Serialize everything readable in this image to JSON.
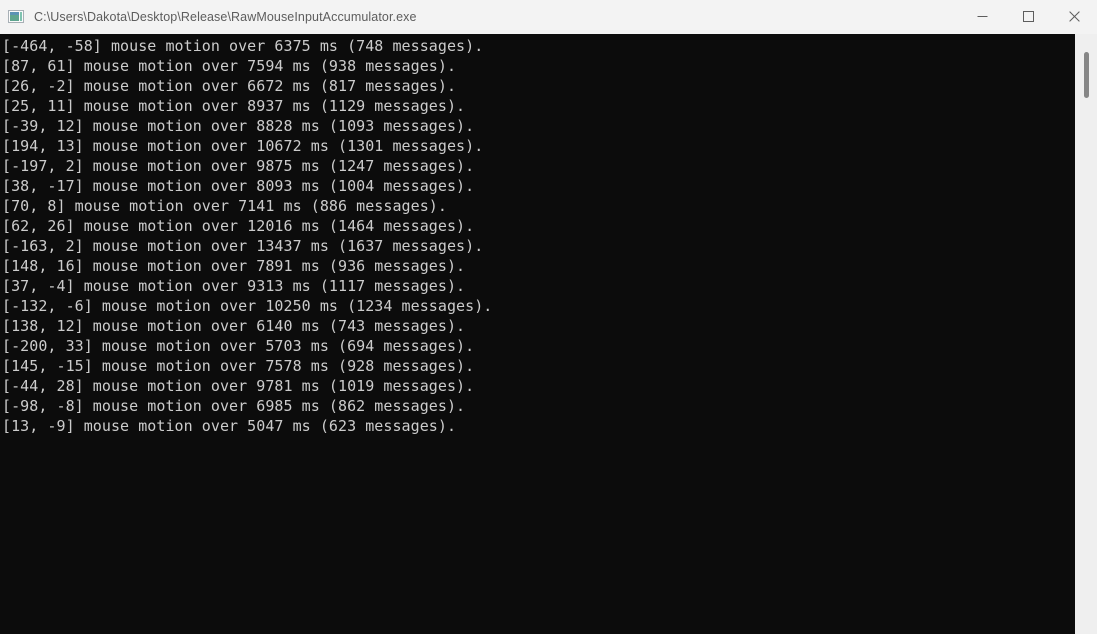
{
  "window": {
    "title": "C:\\Users\\Dakota\\Desktop\\Release\\RawMouseInputAccumulator.exe",
    "icon_name": "console-app-icon",
    "background_color": "#0c0c0c",
    "titlebar_color": "#f3f3f3",
    "text_color": "#cccccc",
    "title_text_color": "#5d5d5d"
  },
  "controls": {
    "minimize_label": "Minimize",
    "maximize_label": "Maximize",
    "close_label": "Close"
  },
  "scrollbar": {
    "thumb_color": "#868686",
    "track_color": "#efefef"
  },
  "console": {
    "lines": [
      "[-464, -58] mouse motion over 6375 ms (748 messages).",
      "[87, 61] mouse motion over 7594 ms (938 messages).",
      "[26, -2] mouse motion over 6672 ms (817 messages).",
      "[25, 11] mouse motion over 8937 ms (1129 messages).",
      "[-39, 12] mouse motion over 8828 ms (1093 messages).",
      "[194, 13] mouse motion over 10672 ms (1301 messages).",
      "[-197, 2] mouse motion over 9875 ms (1247 messages).",
      "[38, -17] mouse motion over 8093 ms (1004 messages).",
      "[70, 8] mouse motion over 7141 ms (886 messages).",
      "[62, 26] mouse motion over 12016 ms (1464 messages).",
      "[-163, 2] mouse motion over 13437 ms (1637 messages).",
      "[148, 16] mouse motion over 7891 ms (936 messages).",
      "[37, -4] mouse motion over 9313 ms (1117 messages).",
      "[-132, -6] mouse motion over 10250 ms (1234 messages).",
      "[138, 12] mouse motion over 6140 ms (743 messages).",
      "[-200, 33] mouse motion over 5703 ms (694 messages).",
      "[145, -15] mouse motion over 7578 ms (928 messages).",
      "[-44, 28] mouse motion over 9781 ms (1019 messages).",
      "[-98, -8] mouse motion over 6985 ms (862 messages).",
      "[13, -9] mouse motion over 5047 ms (623 messages)."
    ]
  }
}
